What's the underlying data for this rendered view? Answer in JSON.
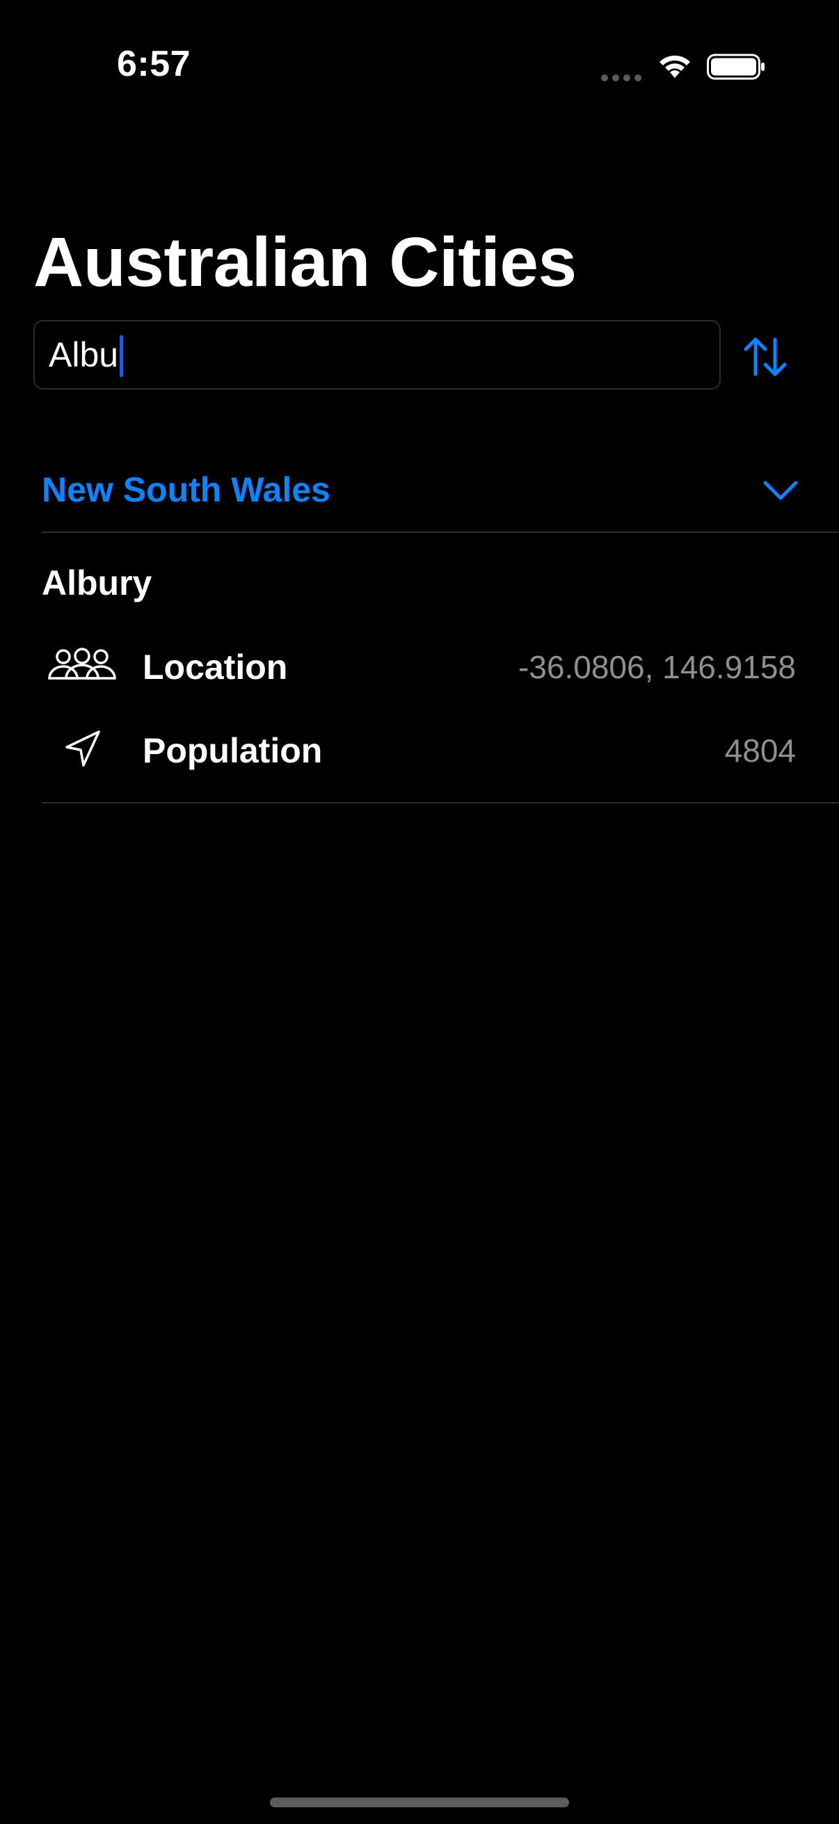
{
  "status_bar": {
    "time": "6:57"
  },
  "header": {
    "title": "Australian Cities"
  },
  "search": {
    "value": "Albu",
    "placeholder": ""
  },
  "sections": [
    {
      "title": "New South Wales",
      "expanded": true,
      "cities": [
        {
          "name": "Albury",
          "rows": [
            {
              "icon": "people-icon",
              "label": "Location",
              "value": "-36.0806, 146.9158"
            },
            {
              "icon": "location-arrow-icon",
              "label": "Population",
              "value": "4804"
            }
          ]
        }
      ]
    }
  ],
  "colors": {
    "accent": "#0a84ff",
    "background": "#000000",
    "secondary_text": "#8e8e93",
    "separator": "#2c2c2e"
  }
}
